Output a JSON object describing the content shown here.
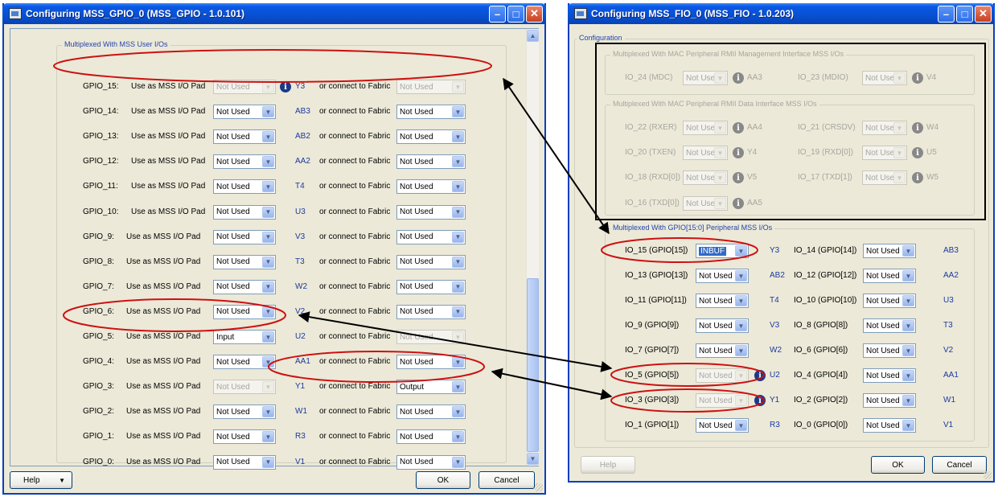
{
  "colors": {
    "titlebar": "#0a58e6",
    "legend": "#2244aa",
    "pin": "#1a3aa0",
    "annotation_ellipse": "#cc1111",
    "arrow": "#000000"
  },
  "left_window": {
    "title": "Configuring MSS_GPIO_0 (MSS_GPIO - 1.0.101)",
    "controls": [
      "minimize-icon",
      "maximize-icon",
      "close-icon"
    ],
    "group_label": "Multiplexed With MSS User I/Os",
    "rows": [
      {
        "name": "GPIO_15:",
        "pad_label": "Use as MSS I/O Pad",
        "pad_value": "Not Used",
        "pad_disabled": true,
        "info": true,
        "pin": "Y3",
        "fabric_label": "or connect to Fabric",
        "fabric_value": "Not Used",
        "fabric_disabled": true
      },
      {
        "name": "GPIO_14:",
        "pad_label": "Use as MSS I/O Pad",
        "pad_value": "Not Used",
        "pad_disabled": false,
        "info": false,
        "pin": "AB3",
        "fabric_label": "or connect to Fabric",
        "fabric_value": "Not Used",
        "fabric_disabled": false
      },
      {
        "name": "GPIO_13:",
        "pad_label": "Use as MSS I/O Pad",
        "pad_value": "Not Used",
        "pad_disabled": false,
        "info": false,
        "pin": "AB2",
        "fabric_label": "or connect to Fabric",
        "fabric_value": "Not Used",
        "fabric_disabled": false
      },
      {
        "name": "GPIO_12:",
        "pad_label": "Use as MSS I/O Pad",
        "pad_value": "Not Used",
        "pad_disabled": false,
        "info": false,
        "pin": "AA2",
        "fabric_label": "or connect to Fabric",
        "fabric_value": "Not Used",
        "fabric_disabled": false
      },
      {
        "name": "GPIO_11:",
        "pad_label": "Use as MSS I/O Pad",
        "pad_value": "Not Used",
        "pad_disabled": false,
        "info": false,
        "pin": "T4",
        "fabric_label": "or connect to Fabric",
        "fabric_value": "Not Used",
        "fabric_disabled": false
      },
      {
        "name": "GPIO_10:",
        "pad_label": "Use as MSS I/O Pad",
        "pad_value": "Not Used",
        "pad_disabled": false,
        "info": false,
        "pin": "U3",
        "fabric_label": "or connect to Fabric",
        "fabric_value": "Not Used",
        "fabric_disabled": false
      },
      {
        "name": "GPIO_9:",
        "pad_label": "Use as MSS I/O Pad",
        "pad_value": "Not Used",
        "pad_disabled": false,
        "info": false,
        "pin": "V3",
        "fabric_label": "or connect to Fabric",
        "fabric_value": "Not Used",
        "fabric_disabled": false
      },
      {
        "name": "GPIO_8:",
        "pad_label": "Use as MSS I/O Pad",
        "pad_value": "Not Used",
        "pad_disabled": false,
        "info": false,
        "pin": "T3",
        "fabric_label": "or connect to Fabric",
        "fabric_value": "Not Used",
        "fabric_disabled": false
      },
      {
        "name": "GPIO_7:",
        "pad_label": "Use as MSS I/O Pad",
        "pad_value": "Not Used",
        "pad_disabled": false,
        "info": false,
        "pin": "W2",
        "fabric_label": "or connect to Fabric",
        "fabric_value": "Not Used",
        "fabric_disabled": false
      },
      {
        "name": "GPIO_6:",
        "pad_label": "Use as MSS I/O Pad",
        "pad_value": "Not Used",
        "pad_disabled": false,
        "info": false,
        "pin": "V2",
        "fabric_label": "or connect to Fabric",
        "fabric_value": "Not Used",
        "fabric_disabled": false
      },
      {
        "name": "GPIO_5:",
        "pad_label": "Use as MSS I/O Pad",
        "pad_value": "Input",
        "pad_disabled": false,
        "info": false,
        "pin": "U2",
        "fabric_label": "or connect to Fabric",
        "fabric_value": "Not Used",
        "fabric_disabled": true
      },
      {
        "name": "GPIO_4:",
        "pad_label": "Use as MSS I/O Pad",
        "pad_value": "Not Used",
        "pad_disabled": false,
        "info": false,
        "pin": "AA1",
        "fabric_label": "or connect to Fabric",
        "fabric_value": "Not Used",
        "fabric_disabled": false
      },
      {
        "name": "GPIO_3:",
        "pad_label": "Use as MSS I/O Pad",
        "pad_value": "Not Used",
        "pad_disabled": true,
        "info": false,
        "pin": "Y1",
        "fabric_label": "or connect to Fabric",
        "fabric_value": "Output",
        "fabric_disabled": false
      },
      {
        "name": "GPIO_2:",
        "pad_label": "Use as MSS I/O Pad",
        "pad_value": "Not Used",
        "pad_disabled": false,
        "info": false,
        "pin": "W1",
        "fabric_label": "or connect to Fabric",
        "fabric_value": "Not Used",
        "fabric_disabled": false
      },
      {
        "name": "GPIO_1:",
        "pad_label": "Use as MSS I/O Pad",
        "pad_value": "Not Used",
        "pad_disabled": false,
        "info": false,
        "pin": "R3",
        "fabric_label": "or connect to Fabric",
        "fabric_value": "Not Used",
        "fabric_disabled": false
      },
      {
        "name": "GPIO_0:",
        "pad_label": "Use as MSS I/O Pad",
        "pad_value": "Not Used",
        "pad_disabled": false,
        "info": false,
        "pin": "V1",
        "fabric_label": "or connect to Fabric",
        "fabric_value": "Not Used",
        "fabric_disabled": false
      }
    ],
    "buttons": {
      "help": "Help",
      "ok": "OK",
      "cancel": "Cancel"
    }
  },
  "right_window": {
    "title": "Configuring MSS_FIO_0 (MSS_FIO - 1.0.203)",
    "controls": [
      "minimize-icon",
      "maximize-icon",
      "close-icon"
    ],
    "config_label": "Configuration",
    "mgmt_group": {
      "label": "Multiplexed With MAC Peripheral RMII Management Interface MSS I/Os",
      "items": [
        {
          "name": "IO_24 (MDC)",
          "value": "Not Used",
          "pin": "AA3"
        },
        {
          "name": "IO_23 (MDIO)",
          "value": "Not Used",
          "pin": "V4"
        }
      ]
    },
    "data_group": {
      "label": "Multiplexed With MAC Peripheral RMII Data Interface MSS I/Os",
      "items": [
        {
          "name": "IO_22 (RXER)",
          "value": "Not Used",
          "pin": "AA4"
        },
        {
          "name": "IO_21 (CRSDV)",
          "value": "Not Used",
          "pin": "W4"
        },
        {
          "name": "IO_20 (TXEN)",
          "value": "Not Used",
          "pin": "Y4"
        },
        {
          "name": "IO_19 (RXD[0])",
          "value": "Not Used",
          "pin": "U5"
        },
        {
          "name": "IO_18 (RXD[0])",
          "value": "Not Used",
          "pin": "V5"
        },
        {
          "name": "IO_17 (TXD[1])",
          "value": "Not Used",
          "pin": "W5"
        },
        {
          "name": "IO_16 (TXD[0])",
          "value": "Not Used",
          "pin": "AA5"
        }
      ]
    },
    "gpio_group": {
      "label": "Multiplexed With GPIO[15:0] Peripheral MSS I/Os",
      "rows": [
        {
          "l_name": "IO_15 (GPIO[15])",
          "l_value": "INBUF",
          "l_disabled": false,
          "l_selected": true,
          "l_info": false,
          "l_pin": "Y3",
          "r_name": "IO_14 (GPIO[14])",
          "r_value": "Not Used",
          "r_pin": "AB3"
        },
        {
          "l_name": "IO_13 (GPIO[13])",
          "l_value": "Not Used",
          "l_disabled": false,
          "l_selected": false,
          "l_info": false,
          "l_pin": "AB2",
          "r_name": "IO_12 (GPIO[12])",
          "r_value": "Not Used",
          "r_pin": "AA2"
        },
        {
          "l_name": "IO_11 (GPIO[11])",
          "l_value": "Not Used",
          "l_disabled": false,
          "l_selected": false,
          "l_info": false,
          "l_pin": "T4",
          "r_name": "IO_10 (GPIO[10])",
          "r_value": "Not Used",
          "r_pin": "U3"
        },
        {
          "l_name": "IO_9 (GPIO[9])",
          "l_value": "Not Used",
          "l_disabled": false,
          "l_selected": false,
          "l_info": false,
          "l_pin": "V3",
          "r_name": "IO_8 (GPIO[8])",
          "r_value": "Not Used",
          "r_pin": "T3"
        },
        {
          "l_name": "IO_7 (GPIO[7])",
          "l_value": "Not Used",
          "l_disabled": false,
          "l_selected": false,
          "l_info": false,
          "l_pin": "W2",
          "r_name": "IO_6 (GPIO[6])",
          "r_value": "Not Used",
          "r_pin": "V2"
        },
        {
          "l_name": "IO_5 (GPIO[5])",
          "l_value": "Not Used",
          "l_disabled": true,
          "l_selected": false,
          "l_info": true,
          "l_pin": "U2",
          "r_name": "IO_4 (GPIO[4])",
          "r_value": "Not Used",
          "r_pin": "AA1"
        },
        {
          "l_name": "IO_3 (GPIO[3])",
          "l_value": "Not Used",
          "l_disabled": true,
          "l_selected": false,
          "l_info": true,
          "l_pin": "Y1",
          "r_name": "IO_2 (GPIO[2])",
          "r_value": "Not Used",
          "r_pin": "W1"
        },
        {
          "l_name": "IO_1 (GPIO[1])",
          "l_value": "Not Used",
          "l_disabled": false,
          "l_selected": false,
          "l_info": false,
          "l_pin": "R3",
          "r_name": "IO_0 (GPIO[0])",
          "r_value": "Not Used",
          "r_pin": "V1"
        }
      ]
    },
    "buttons": {
      "help": "Help",
      "ok": "OK",
      "cancel": "Cancel"
    }
  }
}
